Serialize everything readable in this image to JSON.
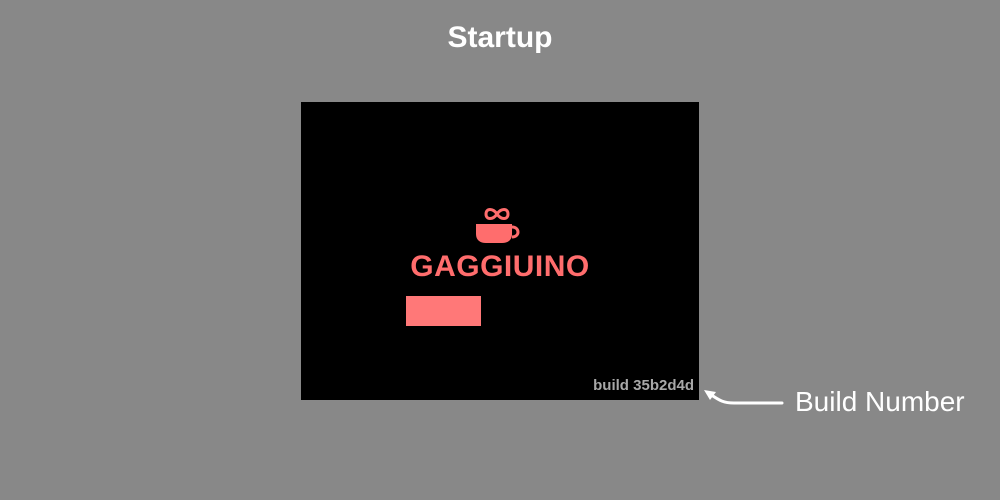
{
  "page": {
    "title": "Startup"
  },
  "screen": {
    "icon": "coffee-cup-infinity-icon",
    "brand": "GAGGIUINO",
    "progress": 0.4,
    "build": "build 35b2d4d"
  },
  "annotation": {
    "label": "Build Number"
  },
  "colors": {
    "background": "#888888",
    "screen": "#000000",
    "accent": "#ff6d6d",
    "progress": "#ff7878",
    "build_text": "#a8a8a8"
  }
}
